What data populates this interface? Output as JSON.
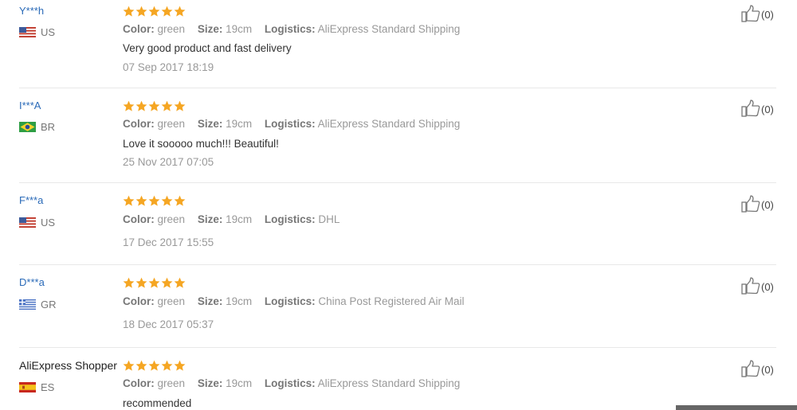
{
  "reviews": [
    {
      "user": "Y***h",
      "country": "US",
      "flag": "us",
      "color_label": "Color:",
      "color": "green",
      "size_label": "Size:",
      "size": "19cm",
      "logistics_label": "Logistics:",
      "logistics": "AliExpress Standard Shipping",
      "text": "Very good product and fast delivery",
      "date": "07 Sep 2017 18:19",
      "likes": "(0)"
    },
    {
      "user": "I***A",
      "country": "BR",
      "flag": "br",
      "color_label": "Color:",
      "color": "green",
      "size_label": "Size:",
      "size": "19cm",
      "logistics_label": "Logistics:",
      "logistics": "AliExpress Standard Shipping",
      "text": "Love it sooooo much!!! Beautiful!",
      "date": "25 Nov 2017 07:05",
      "likes": "(0)"
    },
    {
      "user": "F***a",
      "country": "US",
      "flag": "us",
      "color_label": "Color:",
      "color": "green",
      "size_label": "Size:",
      "size": "19cm",
      "logistics_label": "Logistics:",
      "logistics": "DHL",
      "text": "",
      "date": "17 Dec 2017 15:55",
      "likes": "(0)"
    },
    {
      "user": "D***a",
      "country": "GR",
      "flag": "gr",
      "color_label": "Color:",
      "color": "green",
      "size_label": "Size:",
      "size": "19cm",
      "logistics_label": "Logistics:",
      "logistics": "China Post Registered Air Mail",
      "text": "",
      "date": "18 Dec 2017 05:37",
      "likes": "(0)"
    },
    {
      "user": "AliExpress Shopper",
      "country": "ES",
      "flag": "es",
      "color_label": "Color:",
      "color": "green",
      "size_label": "Size:",
      "size": "19cm",
      "logistics_label": "Logistics:",
      "logistics": "AliExpress Standard Shipping",
      "text": "recommended",
      "date": "",
      "likes": "(0)"
    }
  ],
  "rating_stars": 5,
  "colors": {
    "star": "#f5a623",
    "username": "#2a6ab8"
  }
}
